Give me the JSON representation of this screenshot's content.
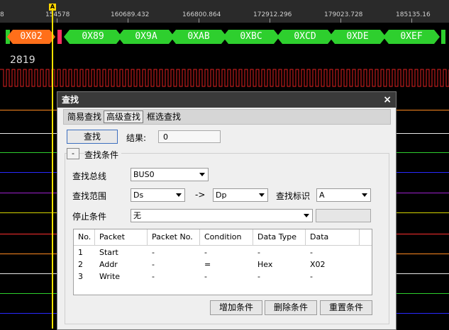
{
  "ruler": {
    "ticks": [
      "8",
      "154578",
      "160689.432",
      "166800.864",
      "172912.296",
      "179023.728",
      "185135.16"
    ],
    "marker": "A"
  },
  "bus": {
    "packets": [
      "0X02",
      "0X89",
      "0X9A",
      "0XAB",
      "0XBC",
      "0XCD",
      "0XDE",
      "0XEF"
    ]
  },
  "signal": {
    "label": "2819"
  },
  "colors": {
    "orange": "#ff6f1a",
    "green": "#2ecf2e",
    "signal": "#e02020",
    "cursor": "#f5e100"
  },
  "dialog": {
    "title": "查找",
    "close": "×",
    "tabs": [
      "简易查找",
      "高级查找",
      "框选查找"
    ],
    "search_button": "查找",
    "result_label": "结果:",
    "result_value": "0",
    "collapse": "-",
    "conditions_label": "查找条件",
    "bus_label": "查找总线",
    "bus_value": "BUS0",
    "range_label": "查找范围",
    "range_from": "Ds",
    "range_arrow": "->",
    "range_to": "Dp",
    "flag_label": "查找标识",
    "flag_value": "A",
    "stop_label": "停止条件",
    "stop_value": "无",
    "table": {
      "headers": [
        "No.",
        "Packet",
        "Packet No.",
        "Condition",
        "Data Type",
        "Data"
      ],
      "rows": [
        [
          "1",
          "Start",
          "-",
          "-",
          "-",
          "-"
        ],
        [
          "2",
          "Addr",
          "-",
          "=",
          "Hex",
          "X02"
        ],
        [
          "3",
          "Write",
          "-",
          "-",
          "-",
          "-"
        ]
      ]
    },
    "buttons": {
      "add": "增加条件",
      "delete": "删除条件",
      "reset": "重置条件"
    }
  }
}
